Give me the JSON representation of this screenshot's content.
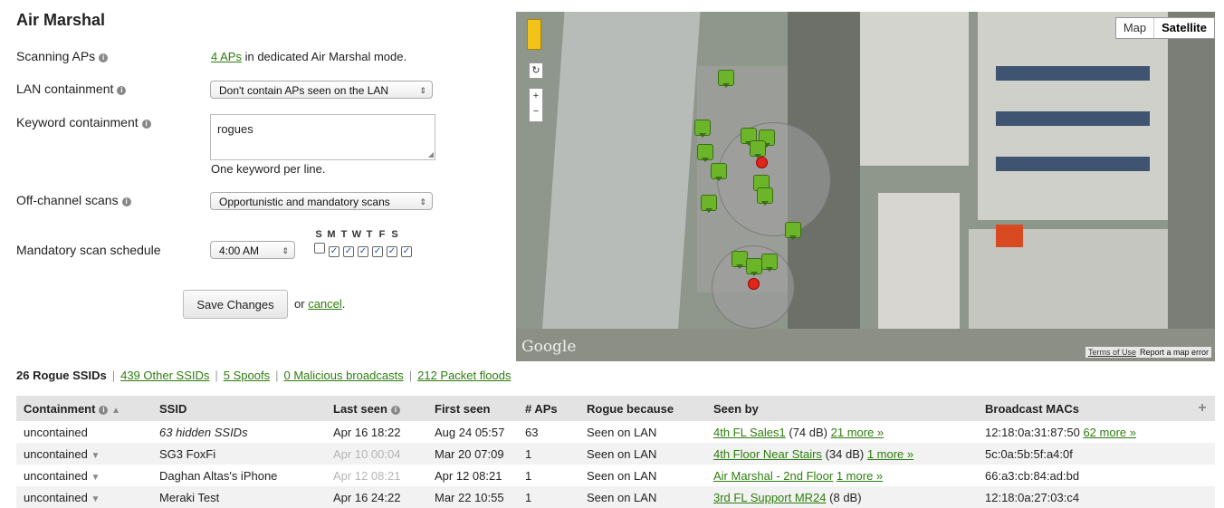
{
  "page_title": "Air Marshal",
  "settings": {
    "scanning_label": "Scanning APs",
    "scanning_link": "4 APs",
    "scanning_text": "in dedicated Air Marshal mode.",
    "lan_label": "LAN containment",
    "lan_value": "Don't contain APs seen on the LAN",
    "keyword_label": "Keyword containment",
    "keyword_value": "rogues",
    "keyword_hint": "One keyword per line.",
    "offchannel_label": "Off-channel scans",
    "offchannel_value": "Opportunistic and mandatory scans",
    "schedule_label": "Mandatory scan schedule",
    "schedule_time": "4:00 AM",
    "days": [
      "S",
      "M",
      "T",
      "W",
      "T",
      "F",
      "S"
    ],
    "days_checked": [
      false,
      true,
      true,
      true,
      true,
      true,
      true
    ],
    "save_label": "Save Changes",
    "or_text": "or",
    "cancel_label": "cancel"
  },
  "map": {
    "type_map": "Map",
    "type_satellite": "Satellite",
    "google": "Google",
    "terms": "Terms of Use",
    "report": "Report a map error"
  },
  "tabs": {
    "active": "26 Rogue SSIDs",
    "links": [
      "439 Other SSIDs",
      "5 Spoofs",
      "0 Malicious broadcasts",
      "212 Packet floods"
    ]
  },
  "table": {
    "headers": [
      "Containment",
      "SSID",
      "Last seen",
      "First seen",
      "# APs",
      "Rogue because",
      "Seen by",
      "Broadcast MACs",
      "+"
    ],
    "rows": [
      {
        "containment": "uncontained",
        "ssid": "63 hidden SSIDs",
        "last": "Apr 16 18:22",
        "first": "Aug 24 05:57",
        "aps": "63",
        "because": "Seen on LAN",
        "seen": "4th FL Sales1",
        "seen_db": "(74 dB)",
        "seen_more": "21 more »",
        "mac": "12:18:0a:31:87:50",
        "mac_more": "62 more »"
      },
      {
        "containment": "uncontained",
        "ssid": "SG3 FoxFi",
        "last": "Apr 10 00:04",
        "first": "Mar 20 07:09",
        "aps": "1",
        "because": "Seen on LAN",
        "seen": "4th Floor Near Stairs",
        "seen_db": "(34 dB)",
        "seen_more": "1 more »",
        "mac": "5c:0a:5b:5f:a4:0f",
        "mac_more": ""
      },
      {
        "containment": "uncontained",
        "ssid": "Daghan Altas's iPhone",
        "last": "Apr 12 08:21",
        "first": "Apr 12 08:21",
        "aps": "1",
        "because": "Seen on LAN",
        "seen": "Air Marshal - 2nd Floor",
        "seen_db": "",
        "seen_more": "1 more »",
        "mac": "66:a3:cb:84:ad:bd",
        "mac_more": ""
      },
      {
        "containment": "uncontained",
        "ssid": "Meraki Test",
        "last": "Apr 16 24:22",
        "first": "Mar 22 10:55",
        "aps": "1",
        "because": "Seen on LAN",
        "seen": "3rd FL Support MR24",
        "seen_db": "(8 dB)",
        "seen_more": "",
        "mac": "12:18:0a:27:03:c4",
        "mac_more": ""
      }
    ]
  }
}
